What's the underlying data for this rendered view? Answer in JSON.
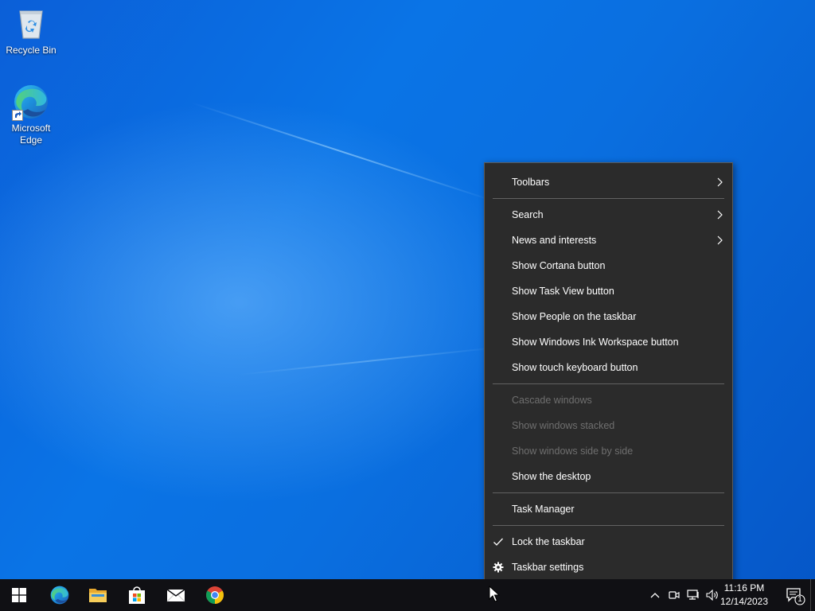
{
  "desktop": {
    "icons": [
      {
        "label": "Recycle Bin",
        "icon": "recycle-bin-icon"
      },
      {
        "label": "Microsoft Edge",
        "icon": "edge-icon"
      }
    ]
  },
  "context_menu": {
    "items": [
      {
        "label": "Toolbars",
        "submenu": true,
        "enabled": true
      },
      {
        "label": "Search",
        "submenu": true,
        "enabled": true
      },
      {
        "label": "News and interests",
        "submenu": true,
        "enabled": true
      },
      {
        "label": "Show Cortana button",
        "enabled": true
      },
      {
        "label": "Show Task View button",
        "enabled": true
      },
      {
        "label": "Show People on the taskbar",
        "enabled": true
      },
      {
        "label": "Show Windows Ink Workspace button",
        "enabled": true
      },
      {
        "label": "Show touch keyboard button",
        "enabled": true
      },
      {
        "label": "Cascade windows",
        "enabled": false
      },
      {
        "label": "Show windows stacked",
        "enabled": false
      },
      {
        "label": "Show windows side by side",
        "enabled": false
      },
      {
        "label": "Show the desktop",
        "enabled": true
      },
      {
        "label": "Task Manager",
        "enabled": true
      },
      {
        "label": "Lock the taskbar",
        "enabled": true,
        "checked": true
      },
      {
        "label": "Taskbar settings",
        "enabled": true,
        "icon": "gear-icon"
      }
    ]
  },
  "taskbar": {
    "pinned": [
      "start-button",
      "edge-icon",
      "file-explorer-icon",
      "microsoft-store-icon",
      "mail-icon",
      "chrome-icon"
    ],
    "tray_icons": [
      "chevron-up-icon",
      "meet-now-icon",
      "network-icon",
      "volume-icon"
    ],
    "time": "11:16 PM",
    "date": "12/14/2023",
    "notification_count": "1"
  },
  "colors": {
    "menu_bg": "#2b2b2b",
    "taskbar_bg": "#101014",
    "disabled_text": "#6f6f6f",
    "accent": "#0078d7"
  }
}
